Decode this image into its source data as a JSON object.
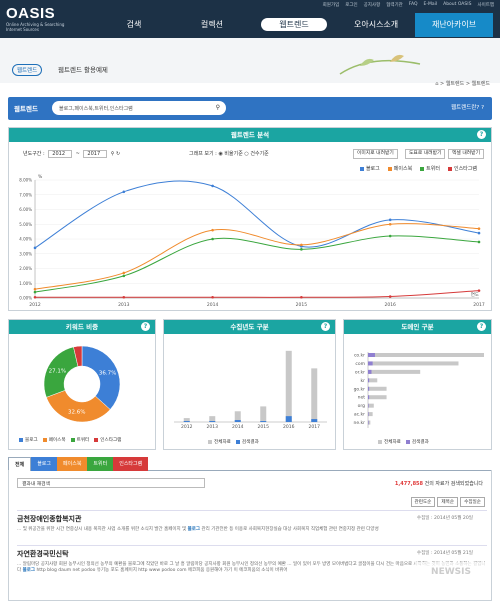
{
  "header": {
    "logo": "OASIS",
    "tagline": "Online Archiving & Searching Internet Sources",
    "util": [
      "회원가입",
      "로그인",
      "공지사항",
      "협력기관",
      "FAQ",
      "E-Mail",
      "About OASIS",
      "사이트맵"
    ],
    "nav": [
      "검색",
      "컬렉션",
      "웹트렌드",
      "오아시스소개",
      "재난아카이브"
    ]
  },
  "page": {
    "pill": "웹트렌드",
    "subtitle": "웹트렌드 활용예제",
    "breadcrumb": "⌂ > 웹트렌드 > 웹트렌드"
  },
  "search": {
    "label": "웹트렌드",
    "placeholder": "블로그,페이스북,트위터,인스타그램",
    "help": "웹트렌드란?"
  },
  "analysis": {
    "title": "웹트렌드 분석",
    "period_label": "년도구간 :",
    "from": "2012",
    "tilde": "~",
    "to": "2017",
    "view_label": "그래프 보기 :",
    "opt1": "비율기준",
    "opt2": "건수기준",
    "buttons": [
      "이미지로 내려받기",
      "도표로 내려받기",
      "엑셀 내려받기"
    ]
  },
  "chart_data": [
    {
      "type": "line",
      "title": "웹트렌드 분석",
      "x": [
        2012,
        2013,
        2014,
        2015,
        2016,
        2017
      ],
      "xlabel": "연도",
      "ylabel": "%",
      "ylim": [
        0,
        8
      ],
      "ticks": [
        "0.00%",
        "1.00%",
        "2.00%",
        "3.00%",
        "4.00%",
        "5.00%",
        "6.00%",
        "7.00%",
        "8.00%"
      ],
      "series": [
        {
          "name": "블로그",
          "color": "#3d7fd6",
          "values": [
            3.4,
            7.2,
            7.6,
            3.5,
            5.3,
            4.4
          ]
        },
        {
          "name": "페이스북",
          "color": "#f08b2d",
          "values": [
            0.6,
            1.7,
            4.6,
            3.6,
            5.0,
            4.7
          ]
        },
        {
          "name": "트위터",
          "color": "#3aa63e",
          "values": [
            0.4,
            1.5,
            4.0,
            3.3,
            4.2,
            3.8
          ]
        },
        {
          "name": "인스타그램",
          "color": "#d63a3a",
          "values": [
            0.05,
            0.05,
            0.05,
            0.05,
            0.1,
            0.5
          ]
        }
      ]
    },
    {
      "type": "pie",
      "title": "키워드 비중",
      "labels": [
        "블로그",
        "페이스북",
        "트위터",
        "인스타그램"
      ],
      "values": [
        36.7,
        32.6,
        27.1,
        3.6
      ],
      "colors": [
        "#3d7fd6",
        "#f08b2d",
        "#3aa63e",
        "#d63a3a"
      ]
    },
    {
      "type": "bar",
      "title": "수집년도 구분",
      "categories": [
        "2012",
        "2013",
        "2014",
        "2015",
        "2016",
        "2017"
      ],
      "series": [
        {
          "name": "전체자료",
          "color": "#c8c8c8",
          "values": [
            4,
            6,
            11,
            16,
            73,
            55
          ]
        },
        {
          "name": "검색결과",
          "color": "#3d7fd6",
          "values": [
            1,
            1,
            2,
            1,
            6,
            3
          ]
        }
      ]
    },
    {
      "type": "bar",
      "title": "도메인 구분",
      "categories": [
        "co.kr",
        "com",
        "or.kr",
        "kr",
        "go.kr",
        "net",
        "org",
        "ac.kr",
        "ne.kr"
      ],
      "series": [
        {
          "name": "전체자료",
          "color": "#c8c8c8",
          "values": [
            100,
            78,
            45,
            8,
            16,
            16,
            5,
            4,
            2
          ]
        },
        {
          "name": "검색결과",
          "color": "#8f7fd0",
          "values": [
            6,
            4,
            3,
            1,
            1,
            1,
            0.5,
            0.5,
            0.5
          ]
        }
      ]
    }
  ],
  "results": {
    "tabs": [
      "전체",
      "블로그",
      "페이스북",
      "트위터",
      "인스타그램"
    ],
    "filter": "결과내 재검색",
    "count": "1,477,858",
    "count_suffix": "건의 자료가 검색되었습니다",
    "sort": [
      "관련도순",
      "제목순",
      "수집일순"
    ],
    "items": [
      {
        "title": "금천장애인종합복지관",
        "date": "수집일 : 2014년 05월 20일",
        "body": "... 및 위공간을 위한 시간 연중상시 내용 복지관 사업 소개를 위한 소식지 발간 홈페이지 및",
        "hl": "블로그",
        "body2": "관리 기관전반 등 이용로 사회복지현장실습 대상 사회복지 직업체험 관련 연중지정 관련 다양성"
      },
      {
        "title": "자연환경국민신탁",
        "date": "수집일 : 2014년 05월 21일",
        "body": "... 알림마당 공지사항 회원 농부시인 정의선 농부의 예환을 블로그에 작았던 바로 그 날 흥 알림마당 공지사항 회원 농부시인 정의선 농부의 예환 ... 일이 있어 모두 방영 모이버법다고 골점이을 다시 건는 마음으로 시작하는 것이 농민과 소통하는 길입니다",
        "hl": "블로그",
        "body2": "http blog daum net podoo 유기농 포도 홈페이지 http www podoo com 에코피움 응원해야 가기 이 에코피움의 소식이 바뀌어"
      }
    ]
  }
}
